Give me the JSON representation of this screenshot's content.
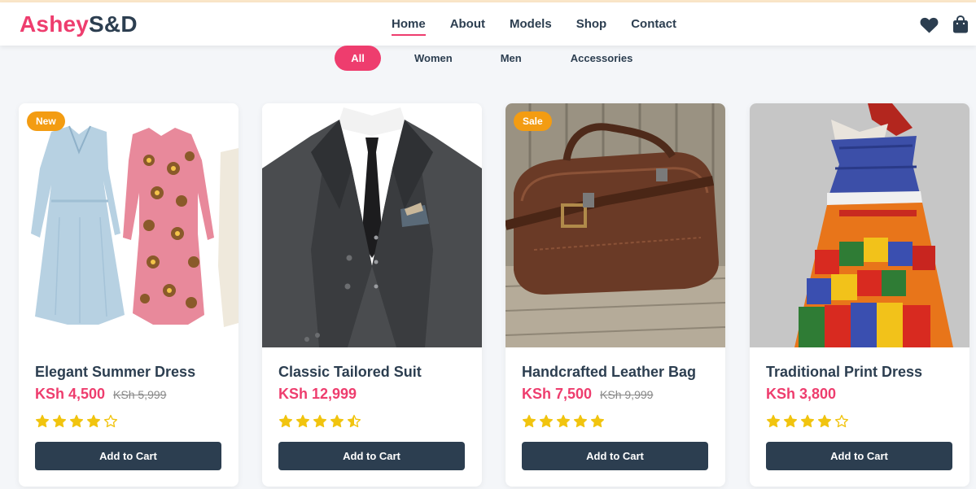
{
  "brand": {
    "part1": "Ashey",
    "part2": "S&D"
  },
  "nav": {
    "items": [
      "Home",
      "About",
      "Models",
      "Shop",
      "Contact"
    ]
  },
  "header_icons": [
    "heart-icon",
    "shopping-bag-icon"
  ],
  "filters": [
    "All",
    "Women",
    "Men",
    "Accessories"
  ],
  "products": [
    {
      "name": "Elegant Summer Dress",
      "price": "KSh 4,500",
      "old_price": "KSh 5,999",
      "badge": "New",
      "rating": 4,
      "cta": "Add to Cart"
    },
    {
      "name": "Classic Tailored Suit",
      "price": "KSh 12,999",
      "old_price": "",
      "badge": "",
      "rating": 4.5,
      "cta": "Add to Cart"
    },
    {
      "name": "Handcrafted Leather Bag",
      "price": "KSh 7,500",
      "old_price": "KSh 9,999",
      "badge": "Sale",
      "rating": 5,
      "cta": "Add to Cart"
    },
    {
      "name": "Traditional Print Dress",
      "price": "KSh 3,800",
      "old_price": "",
      "badge": "",
      "rating": 4,
      "cta": "Add to Cart"
    }
  ],
  "colors": {
    "accent": "#ee3d6e",
    "dark": "#2c3e50",
    "badge": "#f39c12",
    "star": "#f1c40f"
  }
}
